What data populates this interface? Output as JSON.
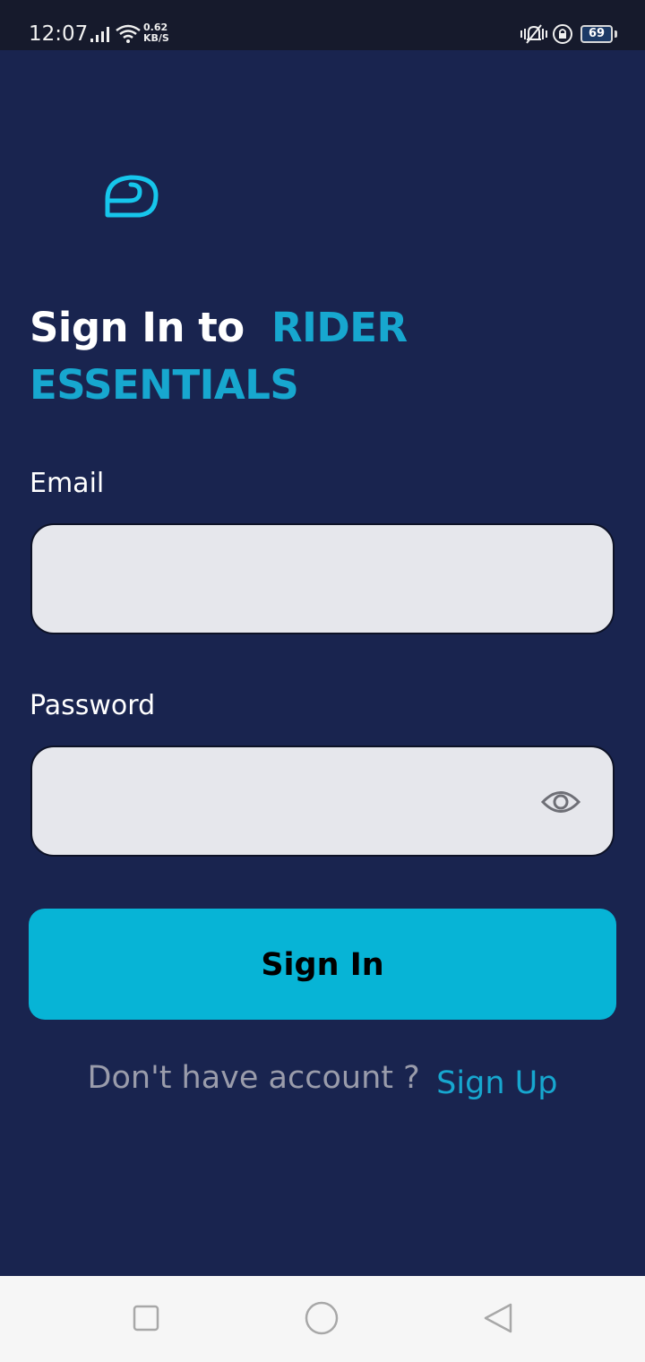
{
  "status_bar": {
    "time": "12:07",
    "net_speed_value": "0.62",
    "net_speed_unit": "KB/S",
    "battery_level": "69",
    "icons": [
      "signal-icon",
      "wifi-icon",
      "vibrate-icon",
      "rotation-lock-icon",
      "battery-icon"
    ]
  },
  "logo": {
    "icon": "helmet-icon",
    "color": "#16c6ec"
  },
  "heading": {
    "prefix": "Sign In to",
    "brand_line1": "RIDER",
    "brand_line2": "ESSENTIALS"
  },
  "form": {
    "email_label": "Email",
    "email_value": "",
    "password_label": "Password",
    "password_value": "",
    "password_toggle_icon": "eye-icon",
    "submit_label": "Sign In"
  },
  "footer": {
    "prompt": "Don't have account ?",
    "signup_link": "Sign Up"
  },
  "nav_bar": {
    "icons": [
      "recent-apps-icon",
      "home-icon",
      "back-icon"
    ]
  },
  "colors": {
    "background": "#19244f",
    "accent": "#17a7cf",
    "button": "#07b4d6",
    "input_background": "#e6e7ec"
  }
}
